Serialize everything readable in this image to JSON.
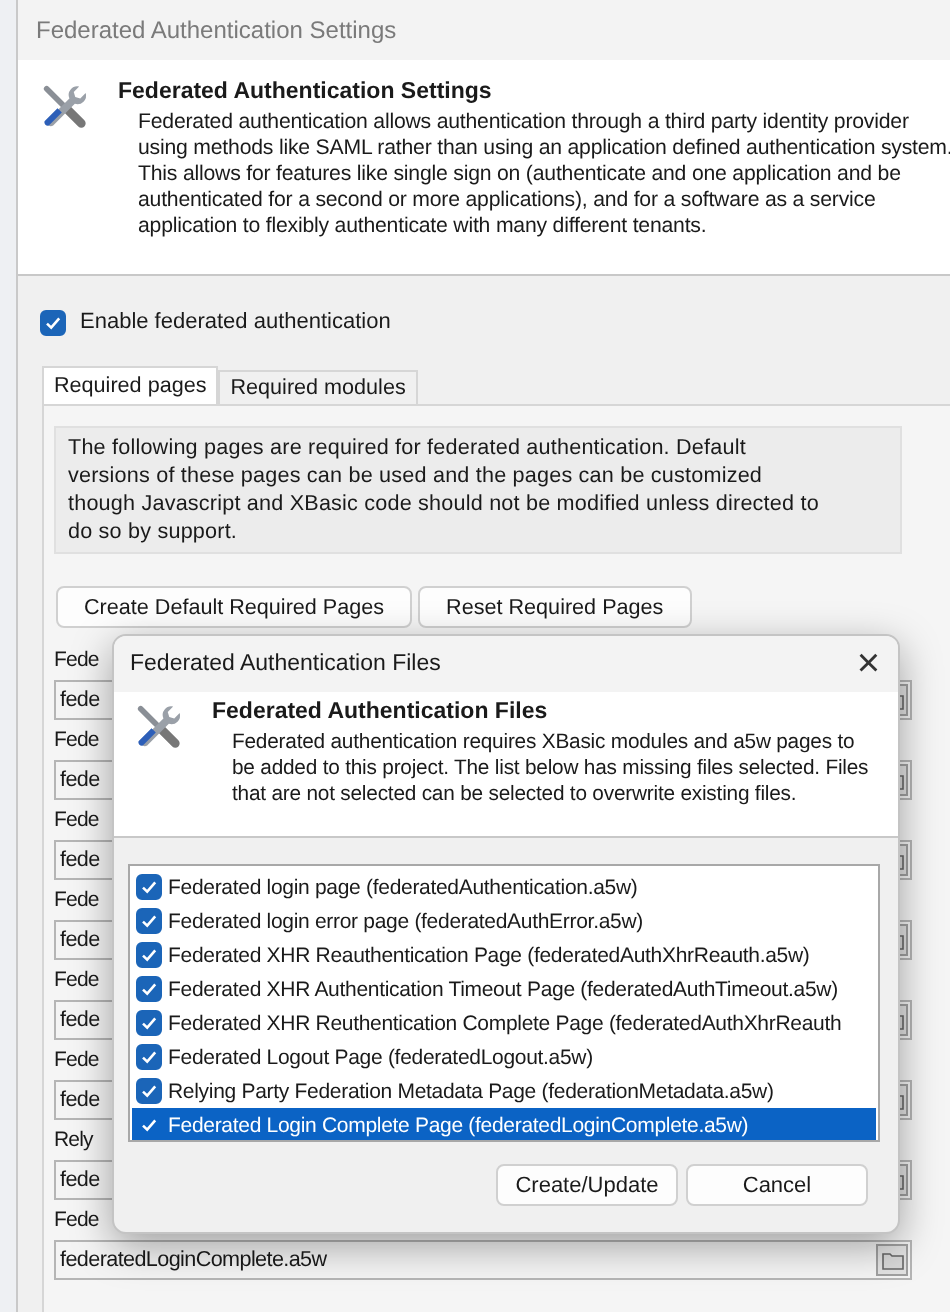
{
  "window": {
    "title": "Federated Authentication Settings"
  },
  "header": {
    "title": "Federated Authentication Settings",
    "description": "Federated authentication allows authentication through a third party identity provider using methods like SAML rather than using an application defined authentication system. This allows for features like single sign on (authenticate and one application and be authenticated for a second or more applications), and for a software as a service application to flexibly authenticate with many different tenants."
  },
  "enable": {
    "label": "Enable federated authentication",
    "checked": true
  },
  "tabs": [
    {
      "label": "Required pages",
      "selected": true
    },
    {
      "label": "Required modules",
      "selected": false
    }
  ],
  "info": "The following pages are required for federated authentication. Default versions of these pages can be used and the pages can be customized though Javascript and XBasic code should not be modified unless directed to do so by support.",
  "buttons": [
    "Create Default Required Pages",
    "Reset Required Pages"
  ],
  "pages": [
    {
      "label": "Fede",
      "value": "fede"
    },
    {
      "label": "Fede",
      "value": "fede"
    },
    {
      "label": "Fede",
      "value": "fede"
    },
    {
      "label": "Fede",
      "value": "fede"
    },
    {
      "label": "Fede",
      "value": "fede"
    },
    {
      "label": "Fede",
      "value": "fede"
    },
    {
      "label": "Rely",
      "value": "fede"
    },
    {
      "label": "Fede",
      "value": "federatedLoginComplete.a5w"
    }
  ],
  "dialog": {
    "title": "Federated Authentication Files",
    "close": "×",
    "header_title": "Federated Authentication Files",
    "description": "Federated authentication requires XBasic modules and a5w pages to be added to this project. The list below has missing files selected. Files that are not selected can be selected to overwrite existing files.",
    "files": [
      {
        "label": "Federated login page (federatedAuthentication.a5w)",
        "checked": true,
        "selected": false
      },
      {
        "label": "Federated login error page (federatedAuthError.a5w)",
        "checked": true,
        "selected": false
      },
      {
        "label": "Federated XHR Reauthentication Page (federatedAuthXhrReauth.a5w)",
        "checked": true,
        "selected": false
      },
      {
        "label": "Federated XHR Authentication Timeout Page (federatedAuthTimeout.a5w)",
        "checked": true,
        "selected": false
      },
      {
        "label": "Federated XHR Reuthentication Complete Page (federatedAuthXhrReauth",
        "checked": true,
        "selected": false
      },
      {
        "label": "Federated Logout Page (federatedLogout.a5w)",
        "checked": true,
        "selected": false
      },
      {
        "label": "Relying Party Federation Metadata Page (federationMetadata.a5w)",
        "checked": true,
        "selected": false
      },
      {
        "label": "Federated Login Complete Page (federatedLoginComplete.a5w)",
        "checked": true,
        "selected": true
      }
    ],
    "buttons": [
      "Create/Update",
      "Cancel"
    ]
  }
}
